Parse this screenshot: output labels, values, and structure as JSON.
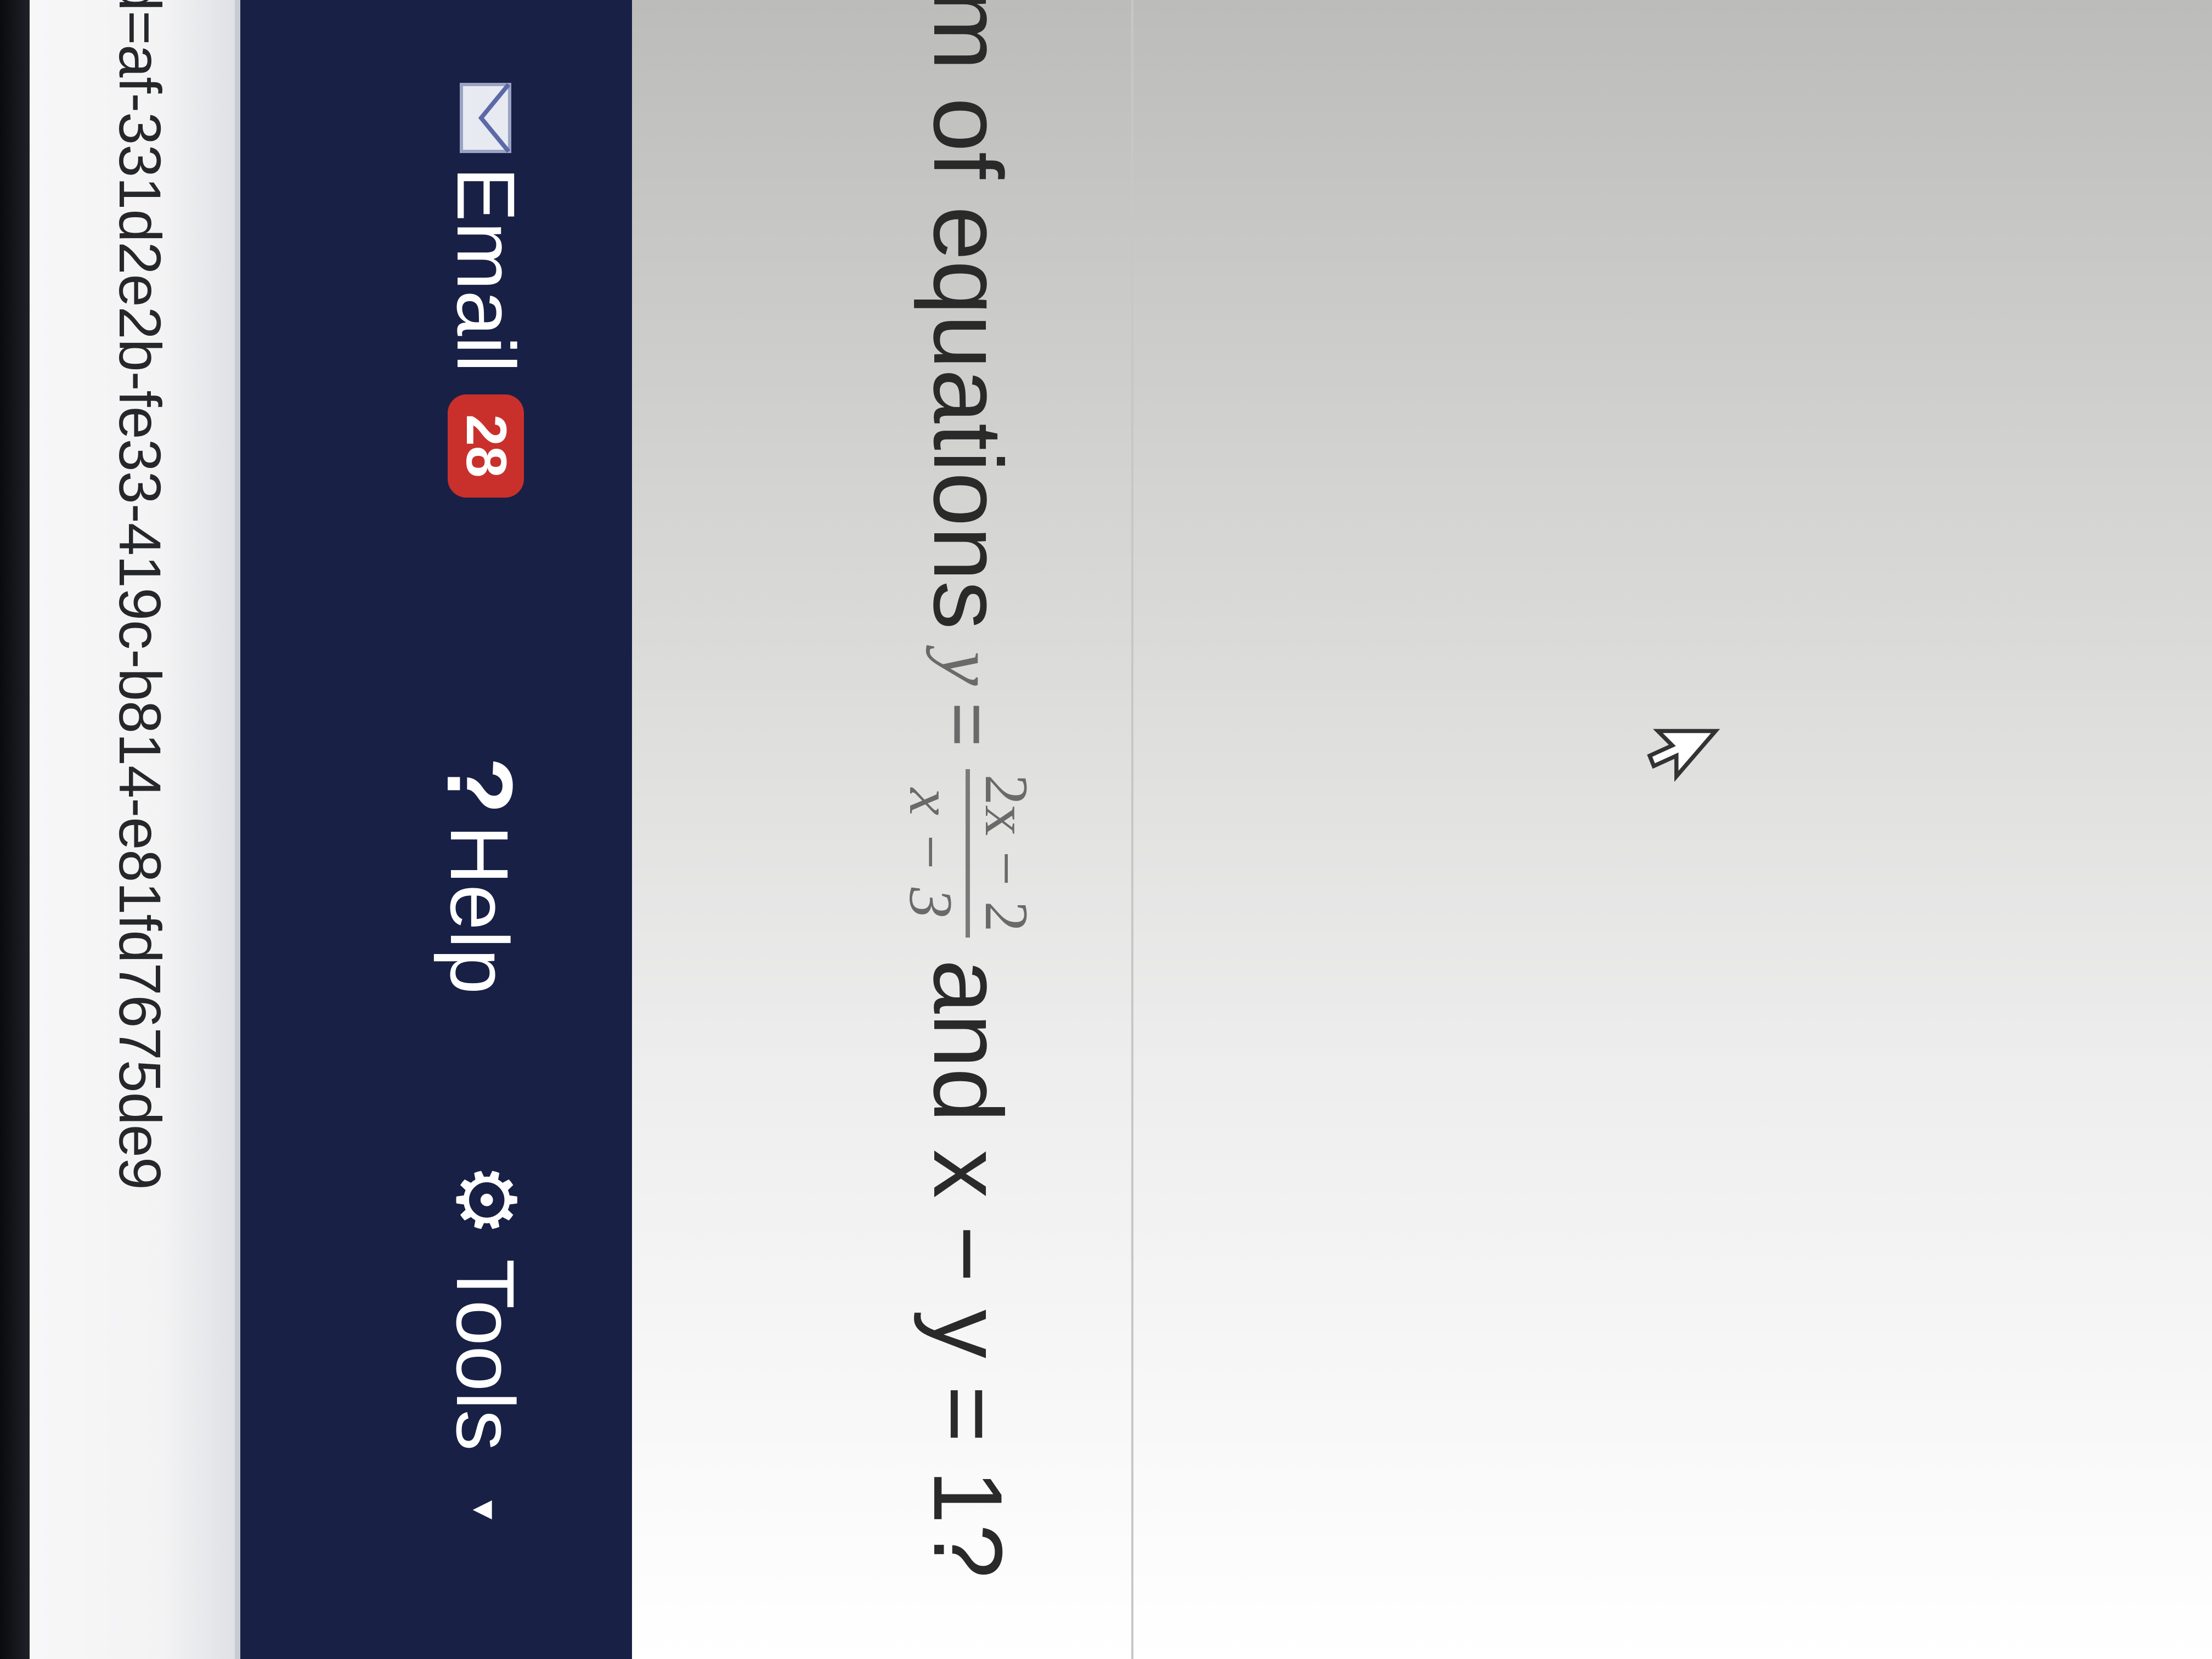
{
  "browser": {
    "url_fragment": "d=af-331d2e2b-fe33-419c-b814-e81fd7675de9"
  },
  "topnav": {
    "email_label": "Email",
    "email_badge": "28",
    "help_glyph": "?",
    "help_label": "Help",
    "tools_glyph": "⚙",
    "tools_label": "Tools",
    "tools_caret": "▾",
    "icons": [
      "mail-icon",
      "help-icon",
      "gear-icon",
      "chevron-down-icon"
    ]
  },
  "question": {
    "prefix": "m of equations",
    "y_var": "y",
    "equals": "=",
    "fraction_numerator": "2x − 2",
    "fraction_denominator": "x − 3",
    "suffix": "and x − y = 1?"
  },
  "colors": {
    "nav_background": "#182045",
    "badge_background": "#c9302c",
    "page_background": "#ffffff"
  }
}
